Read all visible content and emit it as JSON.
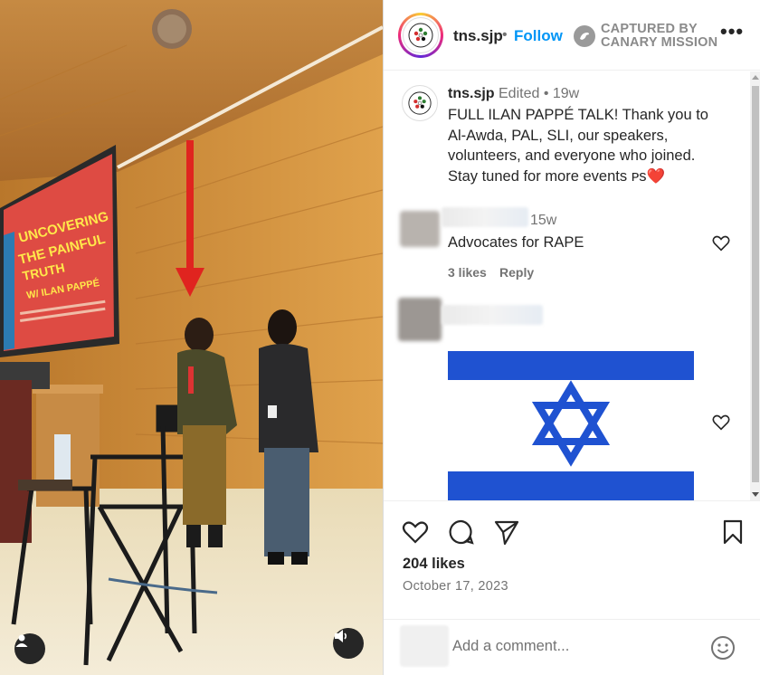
{
  "photo": {
    "projector": {
      "title_lines": [
        "UNCOVERING",
        "THE PAINFUL",
        "TRUTH"
      ],
      "subtitle": "W/ ILAN PAPPÉ"
    },
    "user_icon": "user-icon",
    "sound_icon": "speaker-icon"
  },
  "header": {
    "username": "tns.sjp",
    "separator": "•",
    "follow_label": "Follow",
    "captured_line1": "CAPTURED BY",
    "captured_line2": "CANARY MISSION",
    "more_label": "•••"
  },
  "caption": {
    "username": "tns.sjp",
    "meta": "Edited  •  19w",
    "text": "FULL ILAN PAPPÉ TALK! Thank you to Al-Awda, PAL, SLI, our speakers, volunteers, and everyone who joined. Stay tuned for more events ᴘs❤️"
  },
  "comments": [
    {
      "time": "15w",
      "text": "Advocates for RAPE",
      "likes": "3 likes",
      "reply_label": "Reply"
    },
    {
      "content": "flag-image"
    }
  ],
  "actions": {
    "likes": "204 likes",
    "date": "October 17, 2023"
  },
  "comment_box": {
    "placeholder": "Add a comment..."
  },
  "colors": {
    "follow": "#0095f6",
    "flag_blue": "#1f52d1",
    "muted": "#737373"
  }
}
